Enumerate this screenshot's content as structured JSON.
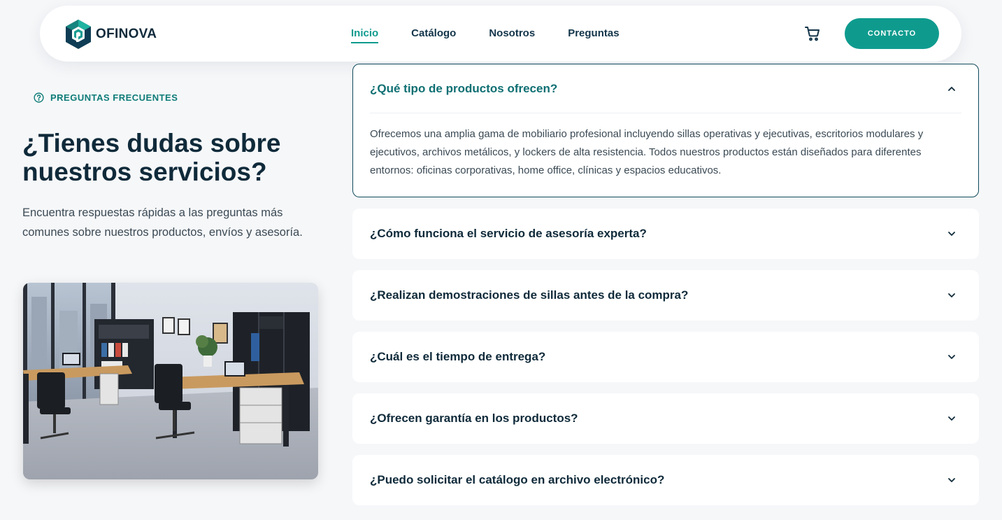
{
  "brand": {
    "name": "OFINOVA"
  },
  "nav": {
    "links": [
      {
        "label": "Inicio",
        "active": true
      },
      {
        "label": "Catálogo",
        "active": false
      },
      {
        "label": "Nosotros",
        "active": false
      },
      {
        "label": "Preguntas",
        "active": false
      }
    ],
    "cart_icon": "cart-icon",
    "contact_label": "CONTACTO"
  },
  "intro": {
    "eyebrow": "PREGUNTAS FRECUENTES",
    "eyebrow_icon": "question-circle-icon",
    "headline": "¿Tienes dudas sobre nuestros servicios?",
    "lead": "Encuentra respuestas rápidas a las preguntas más comunes sobre nuestros productos, envíos y asesoría."
  },
  "faq": [
    {
      "question": "¿Qué tipo de productos ofrecen?",
      "answer": "Ofrecemos una amplia gama de mobiliario profesional incluyendo sillas operativas y ejecutivas, escritorios modulares y ejecutivos, archivos metálicos, y lockers de alta resistencia. Todos nuestros productos están diseñados para diferentes entornos: oficinas corporativas, home office, clínicas y espacios educativos.",
      "open": true
    },
    {
      "question": "¿Cómo funciona el servicio de asesoría experta?",
      "open": false
    },
    {
      "question": "¿Realizan demostraciones de sillas antes de la compra?",
      "open": false
    },
    {
      "question": "¿Cuál es el tiempo de entrega?",
      "open": false
    },
    {
      "question": "¿Ofrecen garantía en los productos?",
      "open": false
    },
    {
      "question": "¿Puedo solicitar el catálogo en archivo electrónico?",
      "open": false
    }
  ],
  "colors": {
    "accent": "#0e9b8e",
    "dark": "#0f2a3a",
    "background": "#f6f7f9"
  }
}
